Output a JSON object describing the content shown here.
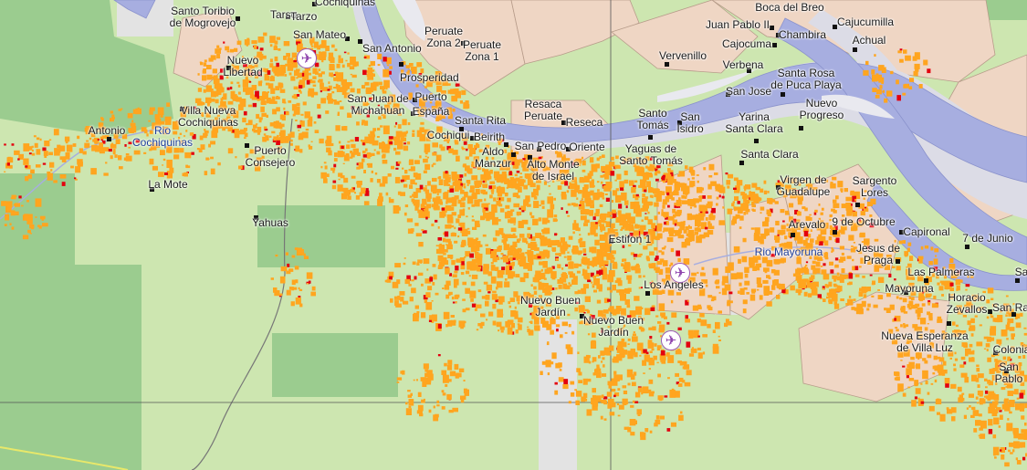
{
  "colors": {
    "background": "#cde6b0",
    "forest_reserve": "#9bcc8f",
    "settlement_area": "#efd6c4",
    "river": "#a7aee0",
    "river_bank": "#dcdce6",
    "deforestation_orange": "#ffa51f",
    "deforestation_red": "#e3000e",
    "road": "#777777",
    "grid_line": "#555555",
    "airport": "#8e44ad",
    "river_label": "#1f3f9a"
  },
  "places": [
    {
      "id": "santo-toribio",
      "label": "Santo Toribio\nde Mogrovejo"
    },
    {
      "id": "tarso",
      "label": "Tarso"
    },
    {
      "id": "tarzo",
      "label": "Tarzo"
    },
    {
      "id": "cochiquinas-top",
      "label": "Cochiquinas"
    },
    {
      "id": "san-mateo",
      "label": "San Mateo"
    },
    {
      "id": "san-antonio",
      "label": "San Antonio"
    },
    {
      "id": "peruate-zona-2",
      "label": "Peruate\nZona 2"
    },
    {
      "id": "peruate-zona-1",
      "label": "Peruate\nZona 1"
    },
    {
      "id": "nuevo-libertad",
      "label": "Nuevo\nLibertad"
    },
    {
      "id": "prosperidad",
      "label": "Prosperidad"
    },
    {
      "id": "puerto",
      "label": "Puerto"
    },
    {
      "id": "espana",
      "label": "España"
    },
    {
      "id": "san-juan-michahuan",
      "label": "San Juan de\nMichahuan"
    },
    {
      "id": "villa-nueva-cochiquinas",
      "label": "Villa Nueva\nCochiquinas"
    },
    {
      "id": "antonio",
      "label": "Antonio"
    },
    {
      "id": "puerto-consejero",
      "label": "Puerto\nConsejero"
    },
    {
      "id": "la-mote",
      "label": "La Mote"
    },
    {
      "id": "yahuas",
      "label": "Yahuas"
    },
    {
      "id": "santa-rita",
      "label": "Santa Rita"
    },
    {
      "id": "cochiqui",
      "label": "Cochiqui"
    },
    {
      "id": "beirith",
      "label": "Beirith"
    },
    {
      "id": "aldo-manzur",
      "label": "Aldo\nManzur"
    },
    {
      "id": "resaca-peruate",
      "label": "Resaca\nPeruate"
    },
    {
      "id": "reseca",
      "label": "Reseca"
    },
    {
      "id": "san-pedro",
      "label": "San Pedro"
    },
    {
      "id": "oriente",
      "label": "Oriente"
    },
    {
      "id": "alto-monte-de-israel",
      "label": "Alto Monte\nde Israel"
    },
    {
      "id": "vervenillo",
      "label": "Vervenillo"
    },
    {
      "id": "juan-pablo-ii",
      "label": "Juan Pablo II"
    },
    {
      "id": "boca-del-breo",
      "label": "Boca del Breo"
    },
    {
      "id": "cajucumilla",
      "label": "Cajucumilla"
    },
    {
      "id": "cajocuma",
      "label": "Cajocuma"
    },
    {
      "id": "chambira",
      "label": "Chambira"
    },
    {
      "id": "achual",
      "label": "Achual"
    },
    {
      "id": "verbena",
      "label": "Verbena"
    },
    {
      "id": "santa-rosa-puca-playa",
      "label": "Santa Rosa\nde Puca Playa"
    },
    {
      "id": "san-jose",
      "label": "San Jose"
    },
    {
      "id": "nuevo-progreso",
      "label": "Nuevo\nProgreso"
    },
    {
      "id": "santo-tomas",
      "label": "Santo\nTomás"
    },
    {
      "id": "san-isidro",
      "label": "San\nIsidro"
    },
    {
      "id": "yarina-santa-clara",
      "label": "Yarina\nSanta Clara"
    },
    {
      "id": "yaguas-de-santo-tomas",
      "label": "Yaguas de\nSanto Tomás"
    },
    {
      "id": "santa-clara",
      "label": "Santa Clara"
    },
    {
      "id": "virgen-de-guadalupe",
      "label": "Virgen de\nGuadalupe"
    },
    {
      "id": "sargento-lores",
      "label": "Sargento\nLores"
    },
    {
      "id": "arevalo",
      "label": "Arevalo"
    },
    {
      "id": "9-de-octubre",
      "label": "9 de Octubre"
    },
    {
      "id": "capironal",
      "label": "Capironal"
    },
    {
      "id": "7-de-junio",
      "label": "7 de Junio"
    },
    {
      "id": "estifon-1",
      "label": "Estifon 1"
    },
    {
      "id": "jesus-de-praga",
      "label": "Jesus de\nPraga"
    },
    {
      "id": "las-palmeras",
      "label": "Las Palmeras"
    },
    {
      "id": "mayoruna",
      "label": "Mayoruna"
    },
    {
      "id": "horacio-zevallos",
      "label": "Horacio\nZevallos"
    },
    {
      "id": "san-ra",
      "label": "San Ra"
    },
    {
      "id": "sa",
      "label": "Sa"
    },
    {
      "id": "los-angeles",
      "label": "Los Angeles"
    },
    {
      "id": "nuevo-buen-jardin-1",
      "label": "Nuevo Buen\nJardín"
    },
    {
      "id": "nuevo-buen-jardin-2",
      "label": "Nuevo Buen\nJardín"
    },
    {
      "id": "nueva-esperanza-villa-luz",
      "label": "Nueva Esperanza\nde Villa Luz"
    },
    {
      "id": "colonia",
      "label": "Colonia"
    },
    {
      "id": "san-pablo",
      "label": "San\nPablo"
    }
  ],
  "rivers": [
    {
      "id": "rio-cochiquinas",
      "label": "Rio\nCochiquinas"
    },
    {
      "id": "rio-mayoruna",
      "label": "Rio Mayoruna"
    }
  ],
  "airports": [
    {
      "id": "airport-san-mateo",
      "icon": "airplane-icon",
      "glyph": "✈"
    },
    {
      "id": "airport-los-angeles",
      "icon": "airplane-icon",
      "glyph": "✈"
    },
    {
      "id": "airport-south",
      "icon": "airplane-icon",
      "glyph": "✈"
    }
  ]
}
